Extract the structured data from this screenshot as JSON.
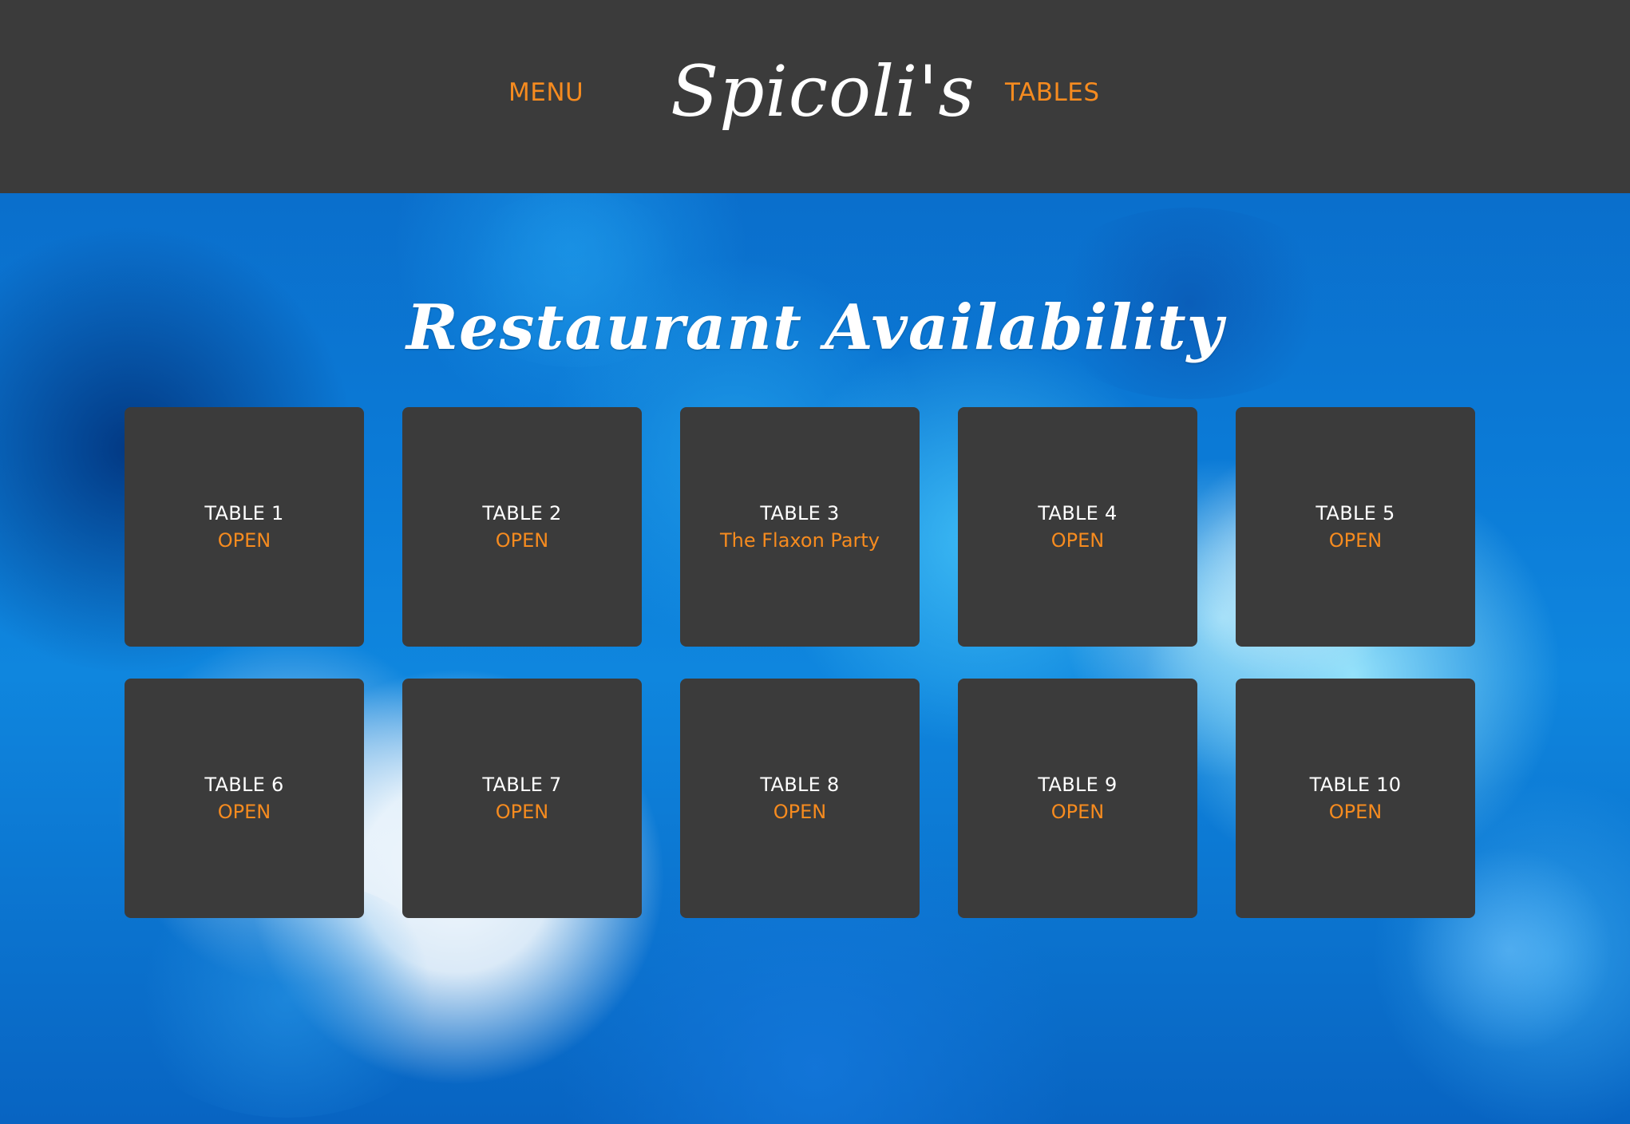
{
  "header": {
    "logo_text": "Spicoli's",
    "nav": {
      "menu_label": "MENU",
      "tables_label": "TABLES"
    }
  },
  "main": {
    "title": "Restaurant Availability",
    "tables": [
      {
        "name": "TABLE 1",
        "status": "OPEN"
      },
      {
        "name": "TABLE 2",
        "status": "OPEN"
      },
      {
        "name": "TABLE 3",
        "status": "The Flaxon Party"
      },
      {
        "name": "TABLE 4",
        "status": "OPEN"
      },
      {
        "name": "TABLE 5",
        "status": "OPEN"
      },
      {
        "name": "TABLE 6",
        "status": "OPEN"
      },
      {
        "name": "TABLE 7",
        "status": "OPEN"
      },
      {
        "name": "TABLE 8",
        "status": "OPEN"
      },
      {
        "name": "TABLE 9",
        "status": "OPEN"
      },
      {
        "name": "TABLE 10",
        "status": "OPEN"
      }
    ]
  },
  "colors": {
    "header_bg": "#3b3b3b",
    "card_bg": "#3b3b3b",
    "accent": "#f68b1f",
    "text_primary": "#ffffff",
    "background": "#0a66c4"
  }
}
